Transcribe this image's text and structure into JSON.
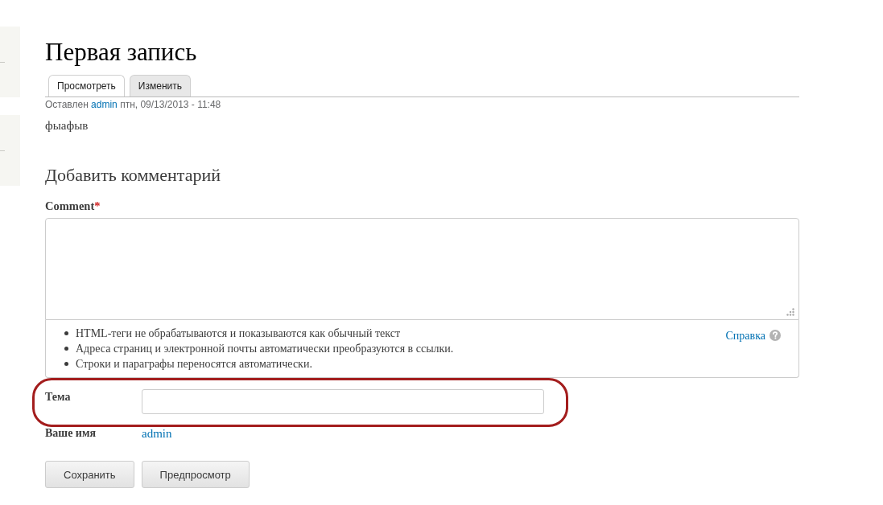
{
  "page": {
    "title": "Первая запись"
  },
  "tabs": [
    {
      "label": "Просмотреть",
      "selected": true
    },
    {
      "label": "Изменить",
      "selected": false
    }
  ],
  "submitted": {
    "prefix": "Оставлен",
    "author": "admin",
    "date": "птн, 09/13/2013 - 11:48"
  },
  "body": "фыафыв",
  "comment_form": {
    "heading": "Добавить комментарий",
    "comment": {
      "label": "Comment",
      "required_mark": "*"
    },
    "tips": [
      "HTML-теги не обрабатываются и показываются как обычный текст",
      "Адреса страниц и электронной почты автоматически преобразуются в ссылки.",
      "Строки и параграфы переносятся автоматически."
    ],
    "help_link": "Справка",
    "subject": {
      "label": "Тема",
      "highlighted": true
    },
    "author": {
      "label": "Ваше имя",
      "name": "admin"
    },
    "buttons": [
      "Сохранить",
      "Предпросмотр"
    ]
  }
}
